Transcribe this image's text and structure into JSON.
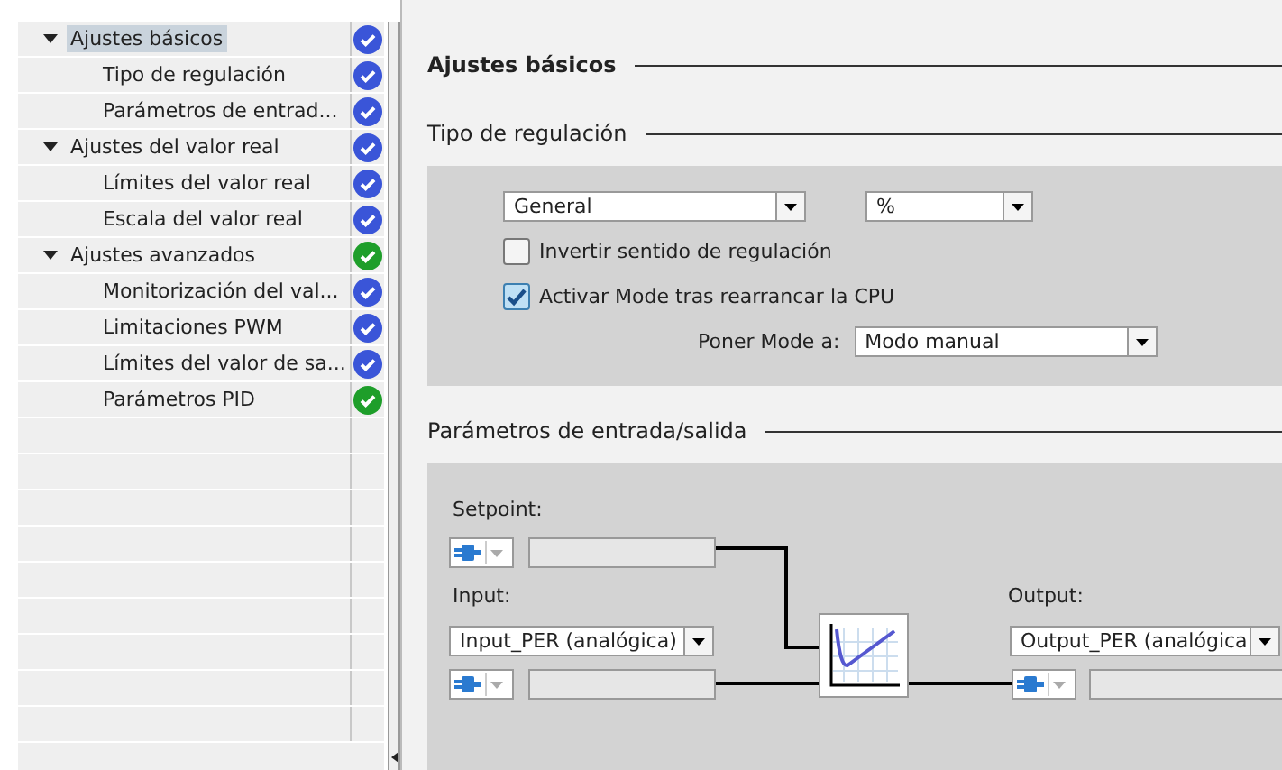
{
  "tree": [
    {
      "label": "Ajustes básicos",
      "selected": true,
      "expanded": true,
      "color": "#3a55d8",
      "children": [
        {
          "label": "Tipo de regulación",
          "selected": false,
          "color": "#3a55d8"
        },
        {
          "label": "Parámetros de entrad...",
          "selected": false,
          "color": "#3a55d8"
        }
      ]
    },
    {
      "label": "Ajustes del valor real",
      "selected": false,
      "expanded": true,
      "color": "#3a55d8",
      "children": [
        {
          "label": "Límites del valor real",
          "selected": false,
          "color": "#3a55d8"
        },
        {
          "label": "Escala del valor real",
          "selected": false,
          "color": "#3a55d8"
        }
      ]
    },
    {
      "label": "Ajustes avanzados",
      "selected": false,
      "expanded": true,
      "color": "#1e9e2a",
      "children": [
        {
          "label": "Monitorización del val...",
          "selected": false,
          "color": "#3a55d8"
        },
        {
          "label": "Limitaciones PWM",
          "selected": false,
          "color": "#3a55d8"
        },
        {
          "label": "Límites del valor de sa...",
          "selected": false,
          "color": "#3a55d8"
        },
        {
          "label": "Parámetros PID",
          "selected": false,
          "color": "#1e9e2a"
        }
      ]
    }
  ],
  "heading": "Ajustes básicos",
  "control_type": {
    "title": "Tipo de regulación",
    "type_select": "General",
    "unit_select": "%",
    "checkboxes": [
      {
        "label": "Invertir sentido de regulación",
        "checked": false
      },
      {
        "label": "Activar Mode tras rearrancar la CPU",
        "checked": true
      }
    ],
    "mode_label": "Poner Mode a:",
    "mode_select": "Modo manual"
  },
  "io": {
    "title": "Parámetros de entrada/salida",
    "setpoint_label": "Setpoint:",
    "input_label": "Input:",
    "input_select": "Input_PER (analógica)",
    "output_label": "Output:",
    "output_select": "Output_PER (analógica"
  }
}
